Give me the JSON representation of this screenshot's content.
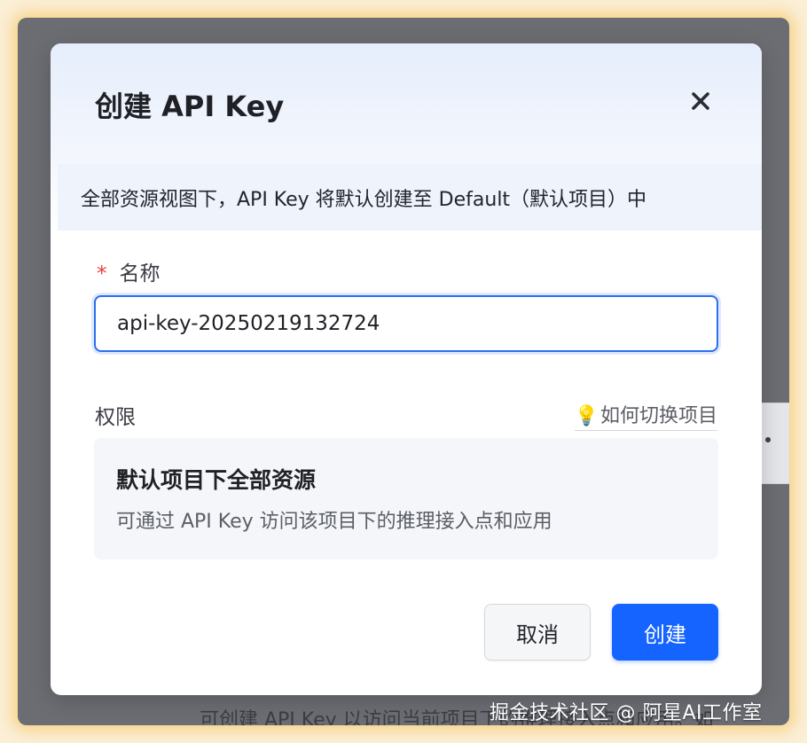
{
  "background": {
    "text": "可创建 API Key 以访问当前项目下的推理接入点和应用。如"
  },
  "watermark": "掘金技术社区 @ 阿星AI工作室",
  "modal": {
    "title": "创建 API Key",
    "close_icon": "close-icon",
    "notice": "全部资源视图下，API Key 将默认创建至 Default（默认项目）中",
    "name_field": {
      "required_mark": "*",
      "label": "名称",
      "value": "api-key-20250219132724"
    },
    "permissions": {
      "label": "权限",
      "help_icon": "lightbulb-icon",
      "help_link": "如何切换项目",
      "scope_title": "默认项目下全部资源",
      "scope_description": "可通过 API Key 访问该项目下的推理接入点和应用"
    },
    "buttons": {
      "cancel": "取消",
      "create": "创建"
    }
  },
  "colors": {
    "primary": "#1664ff",
    "required": "#e0413a",
    "input_focus": "#2a6ef0"
  }
}
